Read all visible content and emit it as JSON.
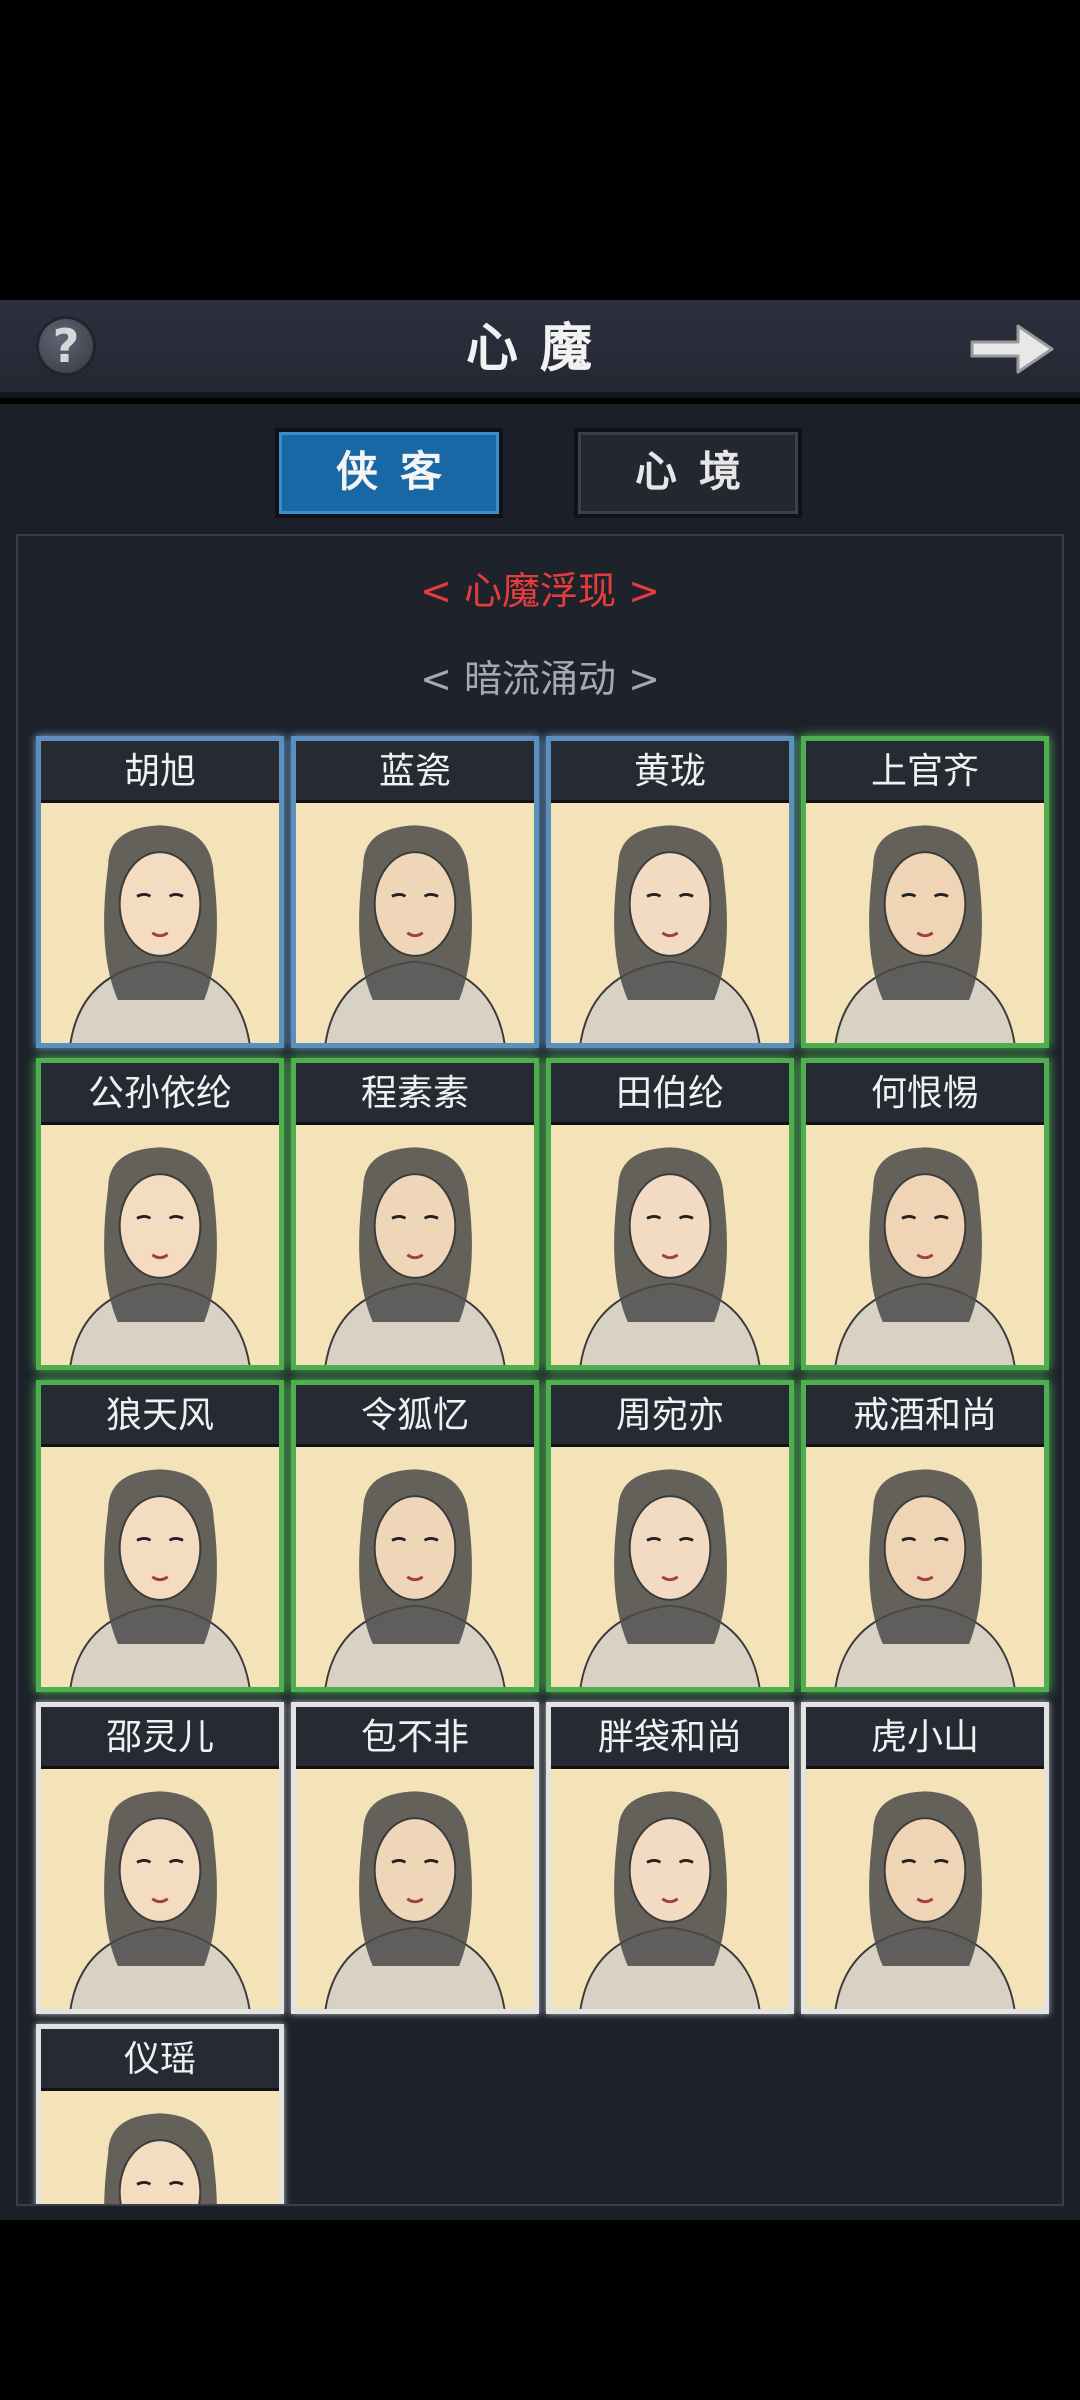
{
  "header": {
    "title": "心魔",
    "help_icon": "question-icon",
    "next_icon": "arrow-right-icon"
  },
  "tabs": [
    {
      "label": "侠客",
      "active": true
    },
    {
      "label": "心境",
      "active": false
    }
  ],
  "sections": [
    {
      "label": "< 心魔浮现 >",
      "color": "#e63c3c"
    },
    {
      "label": "< 暗流涌动 >",
      "color": "#a6a9b0"
    }
  ],
  "characters": [
    {
      "name": "胡旭",
      "rarity": "blue"
    },
    {
      "name": "蓝瓷",
      "rarity": "blue"
    },
    {
      "name": "黄珑",
      "rarity": "blue"
    },
    {
      "name": "上官齐",
      "rarity": "green"
    },
    {
      "name": "公孙依纶",
      "rarity": "green"
    },
    {
      "name": "程素素",
      "rarity": "green"
    },
    {
      "name": "田伯纶",
      "rarity": "green"
    },
    {
      "name": "何恨惕",
      "rarity": "green"
    },
    {
      "name": "狼天风",
      "rarity": "green"
    },
    {
      "name": "令狐忆",
      "rarity": "green"
    },
    {
      "name": "周宛亦",
      "rarity": "green"
    },
    {
      "name": "戒酒和尚",
      "rarity": "green"
    },
    {
      "name": "邵灵儿",
      "rarity": "white"
    },
    {
      "name": "包不非",
      "rarity": "white"
    },
    {
      "name": "胖袋和尚",
      "rarity": "white"
    },
    {
      "name": "虎小山",
      "rarity": "white"
    },
    {
      "name": "仪瑶",
      "rarity": "white"
    }
  ]
}
